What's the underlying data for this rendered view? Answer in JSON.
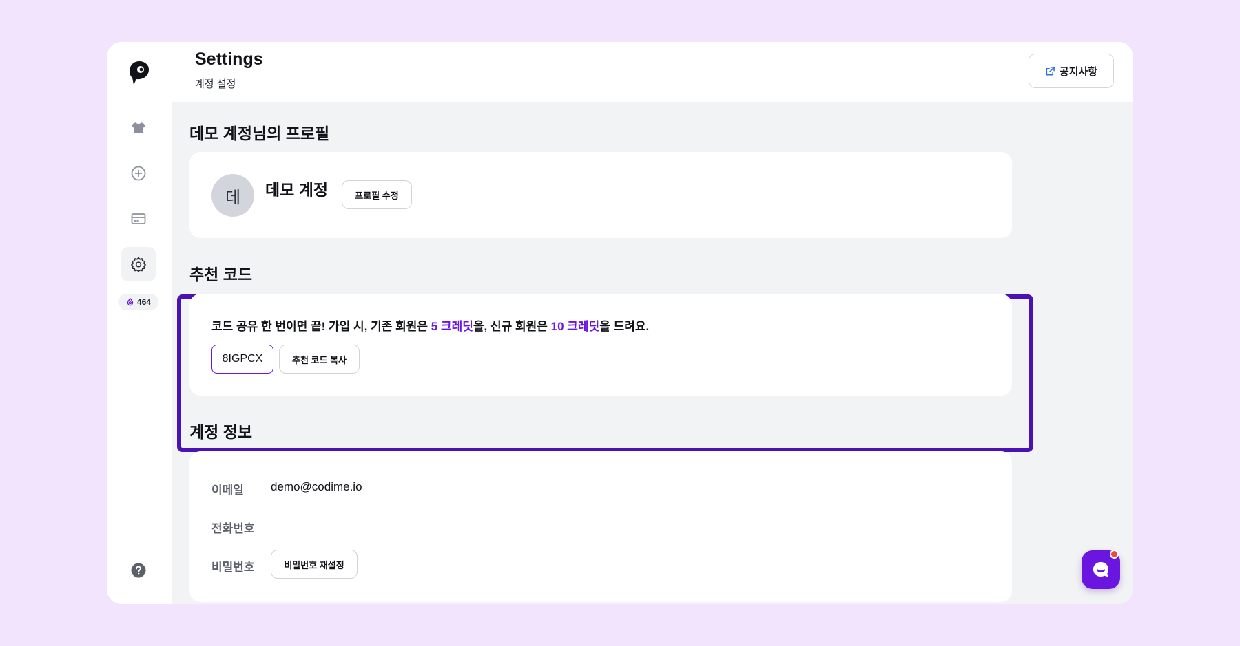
{
  "header": {
    "title": "Settings",
    "subtitle": "계정 설정",
    "notice_label": "공지사항"
  },
  "sidebar": {
    "items": [
      {
        "icon": "shirt-icon"
      },
      {
        "icon": "plus-circle-icon"
      },
      {
        "icon": "card-icon"
      },
      {
        "icon": "gear-icon",
        "active": true
      }
    ],
    "credits": "464"
  },
  "profile": {
    "section_title": "데모 계정님의 프로필",
    "avatar_initial": "데",
    "name": "데모 계정",
    "edit_label": "프로필 수정"
  },
  "referral": {
    "section_title": "추천 코드",
    "text_before": "코드 공유 한 번이면 끝! 가입 시, 기존 회원은 ",
    "existing_credit": "5 크레딧",
    "text_middle": "을, 신규 회원은 ",
    "new_credit": "10 크레딧",
    "text_after": "을 드려요.",
    "code": "8IGPCX",
    "copy_label": "추천 코드 복사"
  },
  "account": {
    "section_title": "계정 정보",
    "email_label": "이메일",
    "email_value": "demo@codime.io",
    "phone_label": "전화번호",
    "password_label": "비밀번호",
    "reset_password_label": "비밀번호 재설정"
  },
  "colors": {
    "accent": "#6a16e0",
    "highlight": "#4a12b5",
    "background": "#f3e4fd"
  }
}
